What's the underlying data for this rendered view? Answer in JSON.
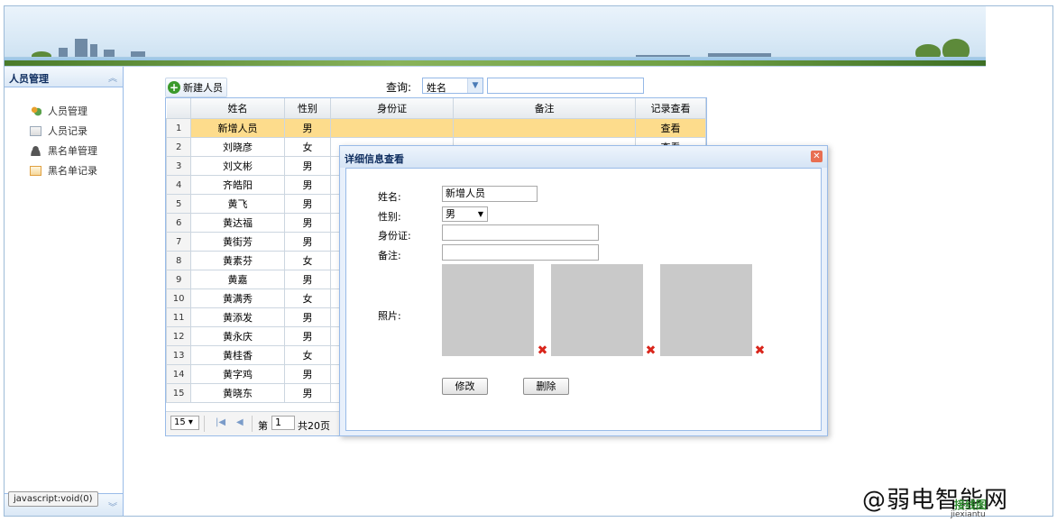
{
  "sidebar": {
    "title": "人员管理",
    "items": [
      {
        "label": "人员管理",
        "icon": "users-icon"
      },
      {
        "label": "人员记录",
        "icon": "record-icon"
      },
      {
        "label": "黑名单管理",
        "icon": "user-black-icon"
      },
      {
        "label": "黑名单记录",
        "icon": "blacklist-record-icon"
      }
    ]
  },
  "status_tip": "javascript:void(0)",
  "toolbar": {
    "new_label": "新建人员",
    "query_label": "查询:",
    "query_field": "姓名",
    "query_value": ""
  },
  "grid": {
    "columns": [
      "姓名",
      "性别",
      "身份证",
      "备注",
      "记录查看"
    ],
    "rows": [
      {
        "n": "1",
        "name": "新增人员",
        "sex": "男",
        "id": "",
        "note": "",
        "view": "查看"
      },
      {
        "n": "2",
        "name": "刘晓彦",
        "sex": "女",
        "id": "",
        "note": "",
        "view": "查看"
      },
      {
        "n": "3",
        "name": "刘文彬",
        "sex": "男",
        "id": "",
        "note": "",
        "view": ""
      },
      {
        "n": "4",
        "name": "齐皓阳",
        "sex": "男",
        "id": "",
        "note": "",
        "view": ""
      },
      {
        "n": "5",
        "name": "黄飞",
        "sex": "男",
        "id": "",
        "note": "",
        "view": ""
      },
      {
        "n": "6",
        "name": "黄达福",
        "sex": "男",
        "id": "",
        "note": "",
        "view": ""
      },
      {
        "n": "7",
        "name": "黄街芳",
        "sex": "男",
        "id": "",
        "note": "",
        "view": ""
      },
      {
        "n": "8",
        "name": "黄素芬",
        "sex": "女",
        "id": "",
        "note": "",
        "view": ""
      },
      {
        "n": "9",
        "name": "黄嘉",
        "sex": "男",
        "id": "",
        "note": "",
        "view": ""
      },
      {
        "n": "10",
        "name": "黄满秀",
        "sex": "女",
        "id": "",
        "note": "",
        "view": ""
      },
      {
        "n": "11",
        "name": "黄添发",
        "sex": "男",
        "id": "",
        "note": "",
        "view": ""
      },
      {
        "n": "12",
        "name": "黄永庆",
        "sex": "男",
        "id": "",
        "note": "",
        "view": ""
      },
      {
        "n": "13",
        "name": "黄桂香",
        "sex": "女",
        "id": "",
        "note": "",
        "view": ""
      },
      {
        "n": "14",
        "name": "黄字鸡",
        "sex": "男",
        "id": "",
        "note": "",
        "view": ""
      },
      {
        "n": "15",
        "name": "黄晓东",
        "sex": "男",
        "id": "",
        "note": "",
        "view": ""
      }
    ],
    "pager": {
      "page_size": "15",
      "page_label": "第",
      "page_value": "1",
      "total_label": "共20页"
    }
  },
  "dialog": {
    "title": "详细信息查看",
    "labels": {
      "name": "姓名:",
      "sex": "性别:",
      "id": "身份证:",
      "note": "备注:",
      "photo": "照片:"
    },
    "values": {
      "name": "新增人员",
      "sex": "男",
      "id": "",
      "note": ""
    },
    "buttons": {
      "edit": "修改",
      "delete": "删除"
    }
  },
  "watermark": {
    "main": "@弱电智能网",
    "sub": "jiexiantu",
    "logo": "接线图"
  }
}
